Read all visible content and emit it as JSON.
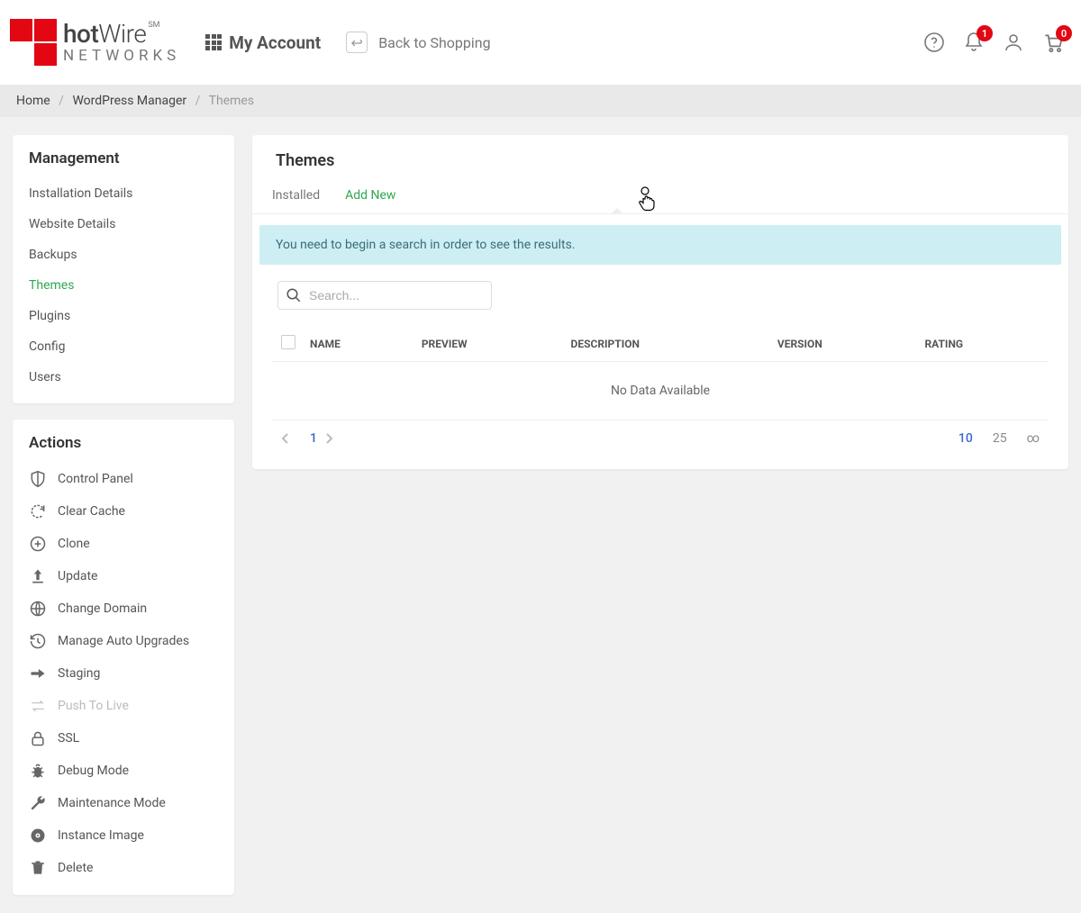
{
  "brand": {
    "name_left": "hot",
    "name_right": "Wire",
    "sm": "SM",
    "sub": "NETWORKS"
  },
  "header": {
    "my_account": "My Account",
    "back": "Back to Shopping",
    "bell_badge": "1",
    "cart_badge": "0"
  },
  "crumbs": {
    "home": "Home",
    "wp": "WordPress Manager",
    "cur": "Themes"
  },
  "sidebar": {
    "management_title": "Management",
    "nav": [
      {
        "label": "Installation Details"
      },
      {
        "label": "Website Details"
      },
      {
        "label": "Backups"
      },
      {
        "label": "Themes",
        "active": true
      },
      {
        "label": "Plugins"
      },
      {
        "label": "Config"
      },
      {
        "label": "Users"
      }
    ],
    "actions_title": "Actions",
    "actions": [
      {
        "label": "Control Panel",
        "icon": "shield-icon"
      },
      {
        "label": "Clear Cache",
        "icon": "refresh-dashed-icon"
      },
      {
        "label": "Clone",
        "icon": "plus-circle-icon"
      },
      {
        "label": "Update",
        "icon": "upload-icon"
      },
      {
        "label": "Change Domain",
        "icon": "globe-icon"
      },
      {
        "label": "Manage Auto Upgrades",
        "icon": "history-icon"
      },
      {
        "label": "Staging",
        "icon": "arrow-right-bold-icon"
      },
      {
        "label": "Push To Live",
        "icon": "swap-icon",
        "disabled": true
      },
      {
        "label": "SSL",
        "icon": "lock-icon"
      },
      {
        "label": "Debug Mode",
        "icon": "bug-icon"
      },
      {
        "label": "Maintenance Mode",
        "icon": "wrench-icon"
      },
      {
        "label": "Instance Image",
        "icon": "disc-icon"
      },
      {
        "label": "Delete",
        "icon": "trash-icon"
      }
    ]
  },
  "main": {
    "title": "Themes",
    "tabs": {
      "installed": "Installed",
      "addnew": "Add New"
    },
    "alert": "You need to begin a search in order to see the results.",
    "search_placeholder": "Search...",
    "columns": {
      "name": "NAME",
      "preview": "PREVIEW",
      "description": "DESCRIPTION",
      "version": "VERSION",
      "rating": "RATING"
    },
    "no_data": "No Data Available",
    "pager": {
      "page": "1",
      "size_10": "10",
      "size_25": "25",
      "inf": "∞"
    }
  }
}
